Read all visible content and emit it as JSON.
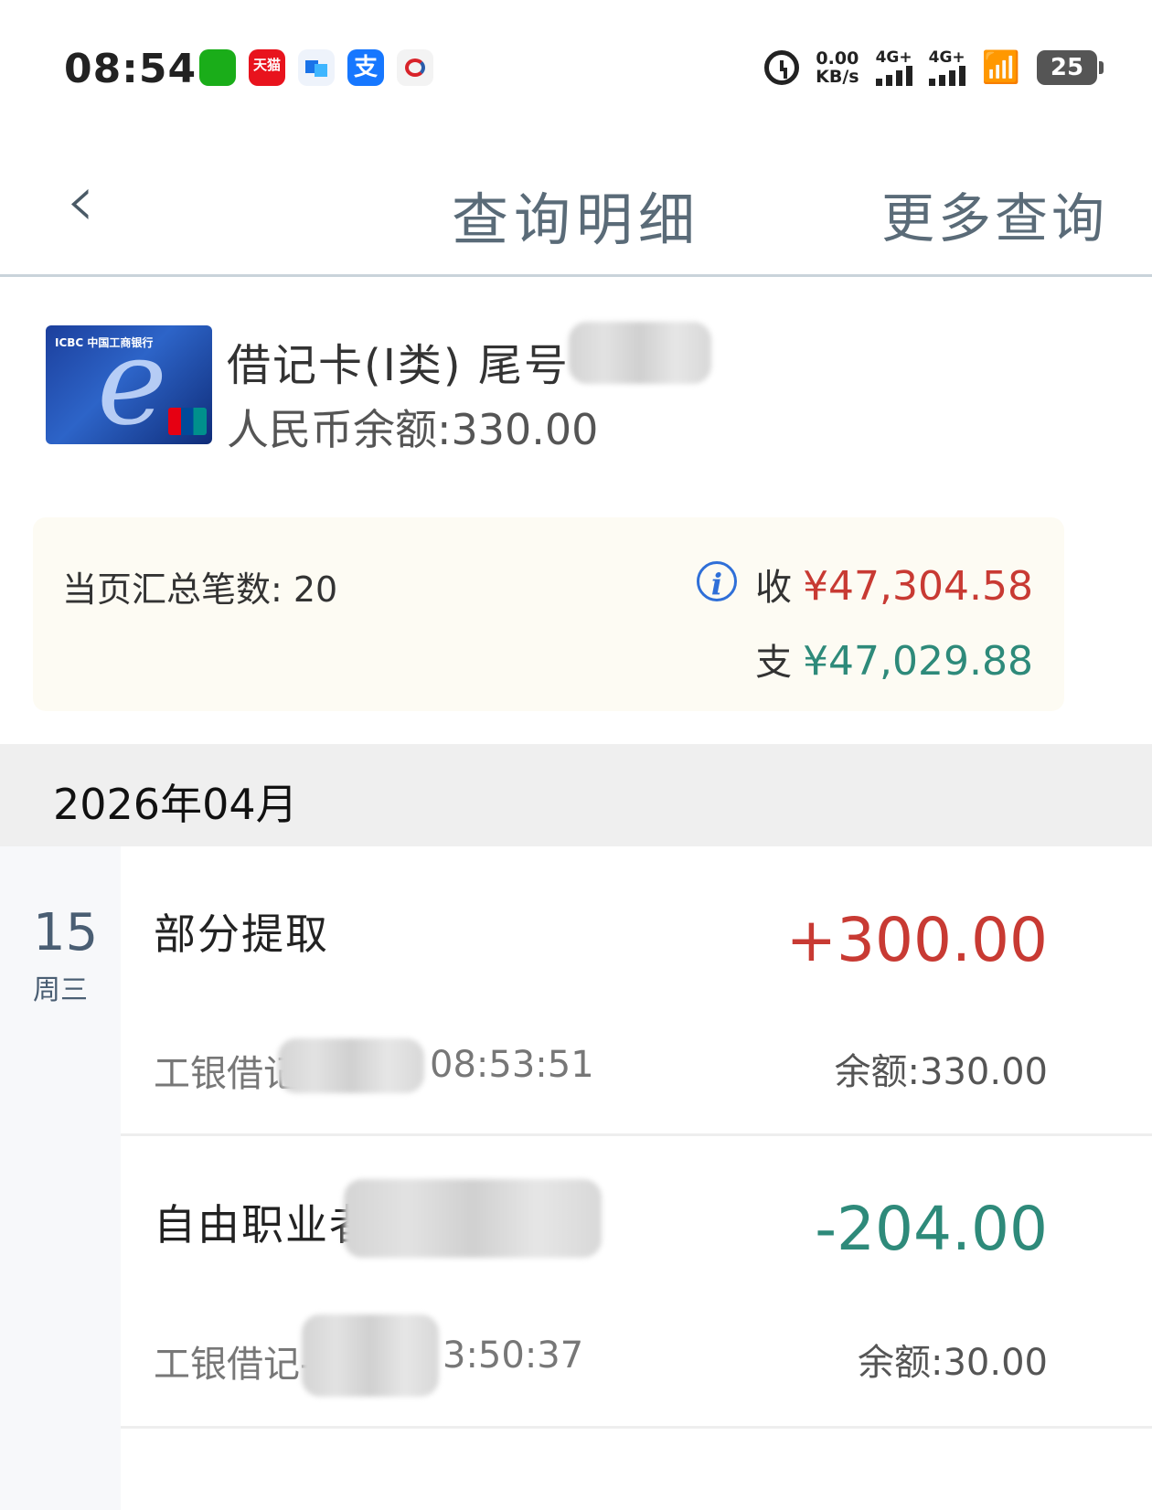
{
  "status_bar": {
    "time": "08:54",
    "apps": [
      "wechat-icon",
      "tmall-icon",
      "blue-app-icon",
      "alipay-icon",
      "china-mobile-icon"
    ],
    "tmall_text": "天猫",
    "alipay_text": "支",
    "speed_value": "0.00",
    "speed_unit": "KB/s",
    "signal1": "4G+",
    "signal2": "4G+",
    "battery": "25"
  },
  "nav": {
    "back_glyph": "‹",
    "title": "查询明细",
    "more": "更多查询"
  },
  "card": {
    "name": "借记卡(Ⅰ类) 尾号",
    "logo_text": "ICBC 中国工商银行",
    "balance": "人民币余额:330.00"
  },
  "summary": {
    "count": "当页汇总笔数: 20",
    "income_label": "收",
    "income": "¥47,304.58",
    "expense_label": "支",
    "expense": "¥47,029.88"
  },
  "month": "2026年04月",
  "day": {
    "date": "15",
    "weekday": "周三"
  },
  "transactions": [
    {
      "title": "部分提取",
      "amount": "+300.00",
      "sub_prefix": "工银借记",
      "sub_suffix": "08:53:51",
      "balance": "余额:330.00"
    },
    {
      "title": "自由职业者",
      "amount": "-204.00",
      "sub_prefix": "工银借记-",
      "sub_suffix": "3:50:37",
      "balance": "余额:30.00"
    }
  ],
  "colors": {
    "income": "#c83a33",
    "expense": "#2e8a7a",
    "nav_text": "#5a6b78",
    "summary_bg": "#fdfbf3"
  }
}
